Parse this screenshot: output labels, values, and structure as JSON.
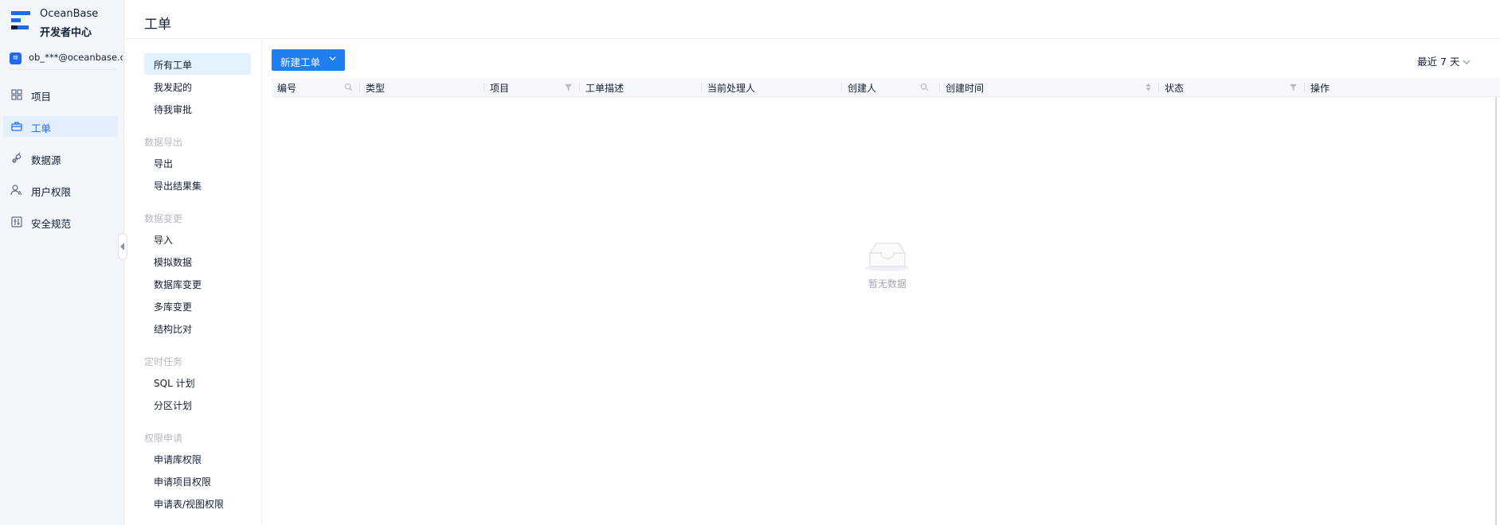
{
  "app": {
    "logo_name": "OceanBase",
    "logo_subtitle": "开发者中心",
    "account": "ob_***@oceanbase.com"
  },
  "sidebar": {
    "items": [
      {
        "label": "项目",
        "icon": "grid-icon",
        "active": false
      },
      {
        "label": "工单",
        "icon": "briefcase-icon",
        "active": true
      },
      {
        "label": "数据源",
        "icon": "link-icon",
        "active": false
      },
      {
        "label": "用户权限",
        "icon": "users-icon",
        "active": false
      },
      {
        "label": "安全规范",
        "icon": "shield-settings-icon",
        "active": false
      }
    ]
  },
  "header": {
    "title": "工单"
  },
  "submenu": {
    "top_items": [
      {
        "label": "所有工单",
        "active": true
      },
      {
        "label": "我发起的",
        "active": false
      },
      {
        "label": "待我审批",
        "active": false
      }
    ],
    "groups": [
      {
        "title": "数据导出",
        "items": [
          "导出",
          "导出结果集"
        ]
      },
      {
        "title": "数据变更",
        "items": [
          "导入",
          "模拟数据",
          "数据库变更",
          "多库变更",
          "结构比对"
        ]
      },
      {
        "title": "定时任务",
        "items": [
          "SQL 计划",
          "分区计划"
        ]
      },
      {
        "title": "权限申请",
        "items": [
          "申请库权限",
          "申请项目权限",
          "申请表/视图权限"
        ]
      }
    ]
  },
  "toolbar": {
    "new_button": "新建工单",
    "time_range": "最近 7 天"
  },
  "table": {
    "columns": [
      "编号",
      "类型",
      "项目",
      "工单描述",
      "当前处理人",
      "创建人",
      "创建时间",
      "状态",
      "操作"
    ],
    "empty_text": "暂无数据"
  },
  "colors": {
    "primary": "#1f7ff0",
    "active_bg": "#e2effd",
    "sidebar_bg": "#f3f6fb"
  }
}
